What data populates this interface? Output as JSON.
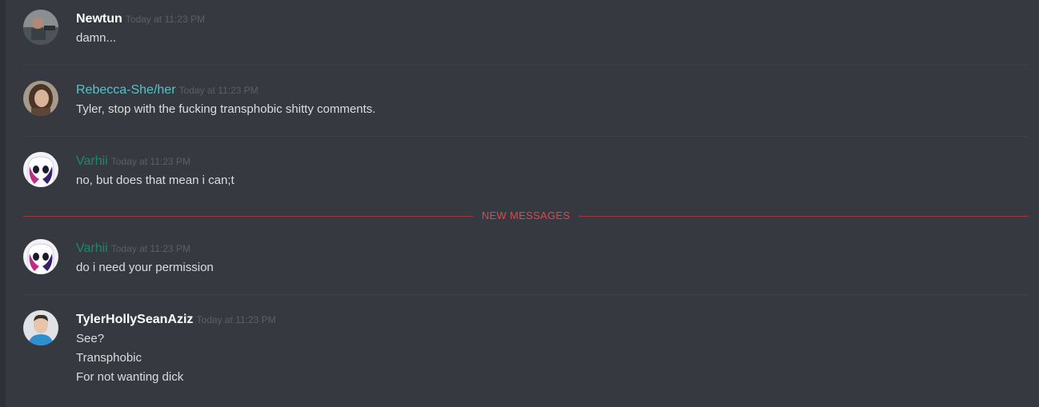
{
  "new_messages_label": "NEW MESSAGES",
  "messages": [
    {
      "author": "Newtun",
      "timestamp": "Today at 11:23 PM",
      "lines": [
        "damn..."
      ]
    },
    {
      "author": "Rebecca-She/her",
      "timestamp": "Today at 11:23 PM",
      "lines": [
        "Tyler, stop with the fucking transphobic shitty comments."
      ]
    },
    {
      "author": "Varhii",
      "timestamp": "Today at 11:23 PM",
      "lines": [
        "no, but does that mean i can;t"
      ]
    },
    {
      "author": "Varhii",
      "timestamp": "Today at 11:23 PM",
      "lines": [
        "do i need your permission"
      ]
    },
    {
      "author": "TylerHollySeanAziz",
      "timestamp": "Today at 11:23 PM",
      "lines": [
        "See?",
        "Transphobic",
        "For not wanting dick"
      ]
    }
  ],
  "colors": {
    "background": "#36393f",
    "rebecca_name": "#59c2c9",
    "varhii_name": "#1b8a6b",
    "new_messages": "#e0474d"
  }
}
